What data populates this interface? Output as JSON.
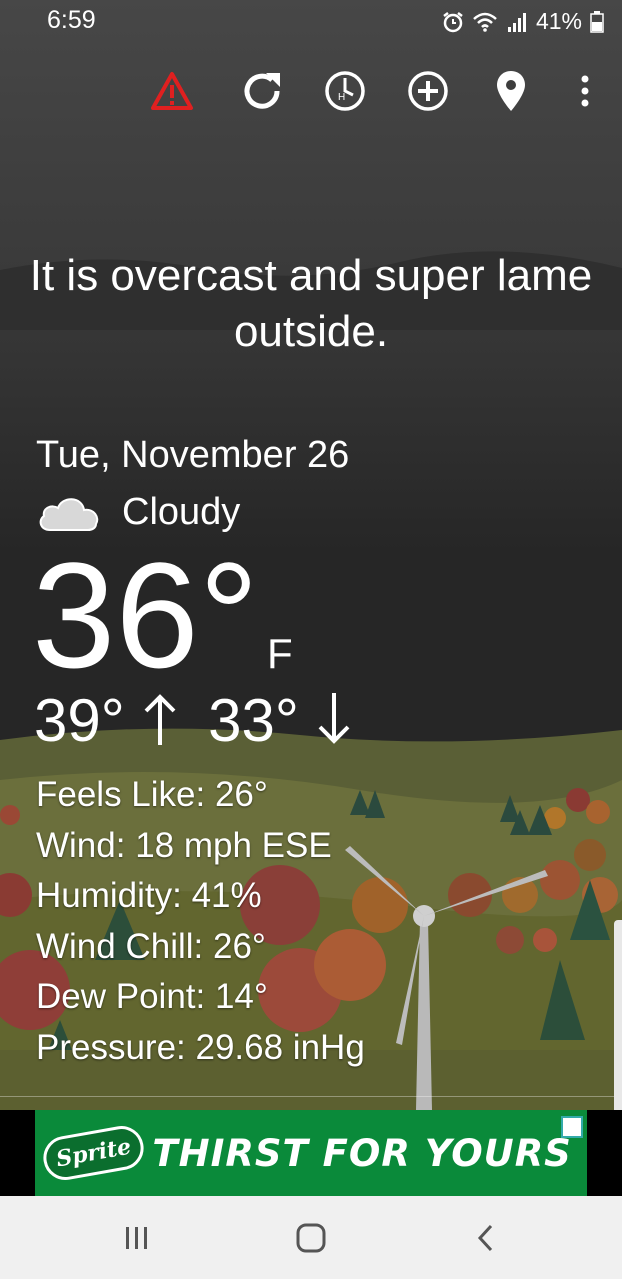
{
  "status_bar": {
    "time": "6:59",
    "battery": "41%"
  },
  "toolbar": {
    "icons": [
      "warning-icon",
      "refresh-icon",
      "hourly-clock-icon",
      "add-location-icon",
      "location-pin-icon",
      "more-vert-icon"
    ]
  },
  "headline": "It is overcast and super lame outside.",
  "weather": {
    "date": "Tue, November 26",
    "condition": "Cloudy",
    "temperature": "36°",
    "unit": "F",
    "high": "39°",
    "low": "33°",
    "details": [
      {
        "label": "Feels Like: 26°"
      },
      {
        "label": "Wind: 18 mph ESE"
      },
      {
        "label": "Humidity: 41%"
      },
      {
        "label": "Wind Chill: 26°"
      },
      {
        "label": "Dew Point: 14°"
      },
      {
        "label": "Pressure: 29.68 inHg"
      }
    ]
  },
  "ad": {
    "brand": "Sprite",
    "tagline": "THIRST FOR YOURS"
  },
  "colors": {
    "warning": "#e02020",
    "ad_green": "#0a8a3a",
    "nav_bg": "#f0f0f0"
  }
}
